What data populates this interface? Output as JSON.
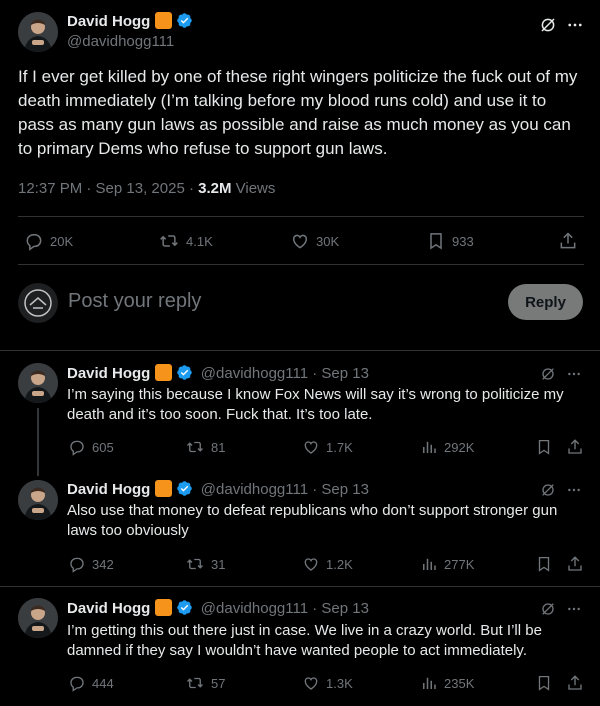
{
  "main_tweet": {
    "name": "David Hogg",
    "handle": "@davidhogg111",
    "text": "If I ever get killed by one of these right wingers politicize the fuck out of my death immediately (I’m talking before my blood runs cold) and use it to pass as many gun laws as possible and raise as much money as you can to primary Dems who refuse to support gun laws.",
    "time": "12:37 PM · Sep 13, 2025 · ",
    "views_count": "3.2M",
    "views_label": " Views",
    "replies": "20K",
    "reposts": "4.1K",
    "likes": "30K",
    "bookmarks": "933"
  },
  "reply_box": {
    "placeholder": "Post your reply",
    "button": "Reply"
  },
  "replies": [
    {
      "name": "David Hogg",
      "handle_date": "@davidhogg111 · Sep 13",
      "text": "I’m saying this because I know Fox News will say it’s wrong to politicize my death and it’s too soon. Fuck that. It’s too late.",
      "replies": "605",
      "reposts": "81",
      "likes": "1.7K",
      "views": "292K"
    },
    {
      "name": "David Hogg",
      "handle_date": "@davidhogg111 · Sep 13",
      "text": "Also use that money to defeat republicans who don’t support stronger gun laws too obviously",
      "replies": "342",
      "reposts": "31",
      "likes": "1.2K",
      "views": "277K"
    },
    {
      "name": "David Hogg",
      "handle_date": "@davidhogg111 · Sep 13",
      "text": "I’m getting this out there just in case. We live in a crazy world. But I’ll be damned if they say I wouldn’t have wanted people to act immediately.",
      "replies": "444",
      "reposts": "57",
      "likes": "1.3K",
      "views": "235K"
    }
  ],
  "colors": {
    "background": "#000000",
    "text": "#e7e9ea",
    "muted": "#71767b",
    "divider": "#2f3336",
    "verified": "#1d9bf0",
    "badge": "#f5931a"
  },
  "icons": [
    "grok-icon",
    "more-icon",
    "reply-icon",
    "repost-icon",
    "like-icon",
    "bookmark-icon",
    "share-icon",
    "views-icon",
    "verified-icon"
  ]
}
